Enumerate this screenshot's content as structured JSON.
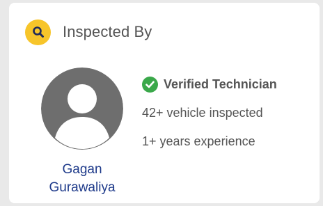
{
  "card": {
    "title": "Inspected By",
    "header_icon": "search-icon",
    "inspector": {
      "first_name": "Gagan",
      "last_name": "Gurawaliya",
      "avatar_icon": "user-avatar-icon"
    },
    "verified": {
      "label": "Verified Technician",
      "icon": "check-circle-icon"
    },
    "stats": [
      "42+ vehicle inspected",
      "1+ years experience"
    ]
  },
  "colors": {
    "accent_yellow": "#f7c52a",
    "verified_green": "#3aa84a",
    "name_blue": "#1e3a8a",
    "text_gray": "#555555",
    "avatar_gray": "#6e6e6e"
  }
}
